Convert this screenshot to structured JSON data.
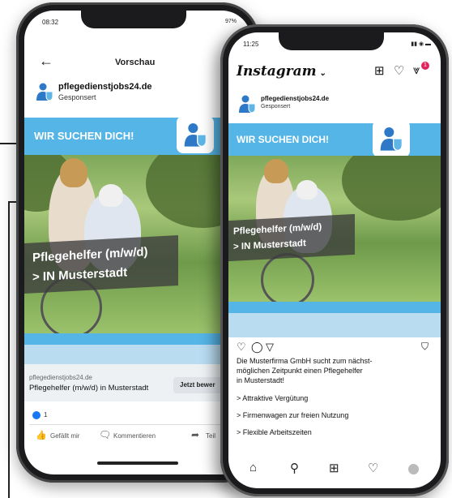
{
  "fb": {
    "time": "08:32",
    "battery": "97%",
    "back_icon": "arrow-left-icon",
    "title": "Vorschau",
    "page_name": "pflegedienstjobs24.de",
    "sponsored": "Gesponsert",
    "banner": "WIR SUCHEN DICH!",
    "job_title": "Pflegehelfer (m/w/d)",
    "location": "> IN Musterstadt",
    "link_domain": "pflegedienstjobs24.de",
    "link_title": "Pflegehelfer (m/w/d) in Musterstadt",
    "cta": "Jetzt bewer",
    "like_count": "1",
    "like": "Gefällt mir",
    "comment": "Kommentieren",
    "share": "Teil"
  },
  "ig": {
    "time": "11:25",
    "logo": "Instagram",
    "page_name": "pflegedienstjobs24.de",
    "sponsored": "Gesponsert",
    "banner": "WIR SUCHEN DICH!",
    "job_title": "Pflegehelfer (m/w/d)",
    "location": "> IN Musterstadt",
    "notification_count": "1",
    "caption_1": "Die Musterfirma GmbH sucht zum nächst-",
    "caption_2": "möglichen Zeitpunkt einen Pflegehelfer",
    "caption_3": "in Musterstadt!",
    "bullet_1": "> Attraktive Vergütung",
    "bullet_2": "> Firmenwagen zur freien Nutzung",
    "bullet_3": "> Flexible Arbeitszeiten"
  },
  "colors": {
    "accent_blue": "#55b5e6",
    "fb_blue": "#1877f2",
    "dark": "#1b1b1d"
  }
}
